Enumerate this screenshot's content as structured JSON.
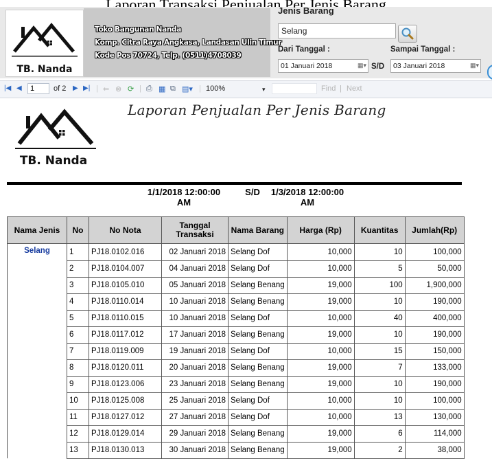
{
  "window": {
    "title": "Laporan Transaksi Penjualan Per Jenis Barang"
  },
  "company": {
    "logo_text": "TB. Nanda",
    "name": "Toko Bangunan Nanda",
    "address": "Komp. Citra Raya Angkasa, Landasan Ulin Timur",
    "contact": "Kode Pos 70724, Telp. (0511)4708039"
  },
  "filter": {
    "jenis_label": "Jenis Barang",
    "jenis_value": "Selang",
    "from_label": "Dari Tanggal :",
    "from_value": "01  Januari  2018",
    "sd_label": "S/D",
    "to_label": "Sampai Tanggal :",
    "to_value": "03  Januari  2018",
    "search_icon": "magnifier-icon"
  },
  "toolbar": {
    "page_current": "1",
    "page_of": "of 2",
    "zoom": "100%",
    "find_label": "Find",
    "separator": "|",
    "next_label": "Next"
  },
  "report": {
    "title": "Laporan Penjualan Per Jenis Barang",
    "date_from": "1/1/2018 12:00:00",
    "date_from_ampm": "AM",
    "sd": "S/D",
    "date_to": "1/3/2018 12:00:00",
    "date_to_ampm": "AM",
    "columns": [
      "Nama Jenis",
      "No",
      "No Nota",
      "Tanggal Transaksi",
      "Nama Barang",
      "Harga (Rp)",
      "Kuantitas",
      "Jumlah(Rp)"
    ],
    "group": "Selang",
    "rows": [
      {
        "no": "1",
        "nota": "PJ18.0102.016",
        "tanggal": "02 Januari 2018",
        "barang": "Selang Dof",
        "harga": "10,000",
        "qty": "10",
        "jumlah": "100,000"
      },
      {
        "no": "2",
        "nota": "PJ18.0104.007",
        "tanggal": "04 Januari 2018",
        "barang": "Selang Dof",
        "harga": "10,000",
        "qty": "5",
        "jumlah": "50,000"
      },
      {
        "no": "3",
        "nota": "PJ18.0105.010",
        "tanggal": "05 Januari 2018",
        "barang": "Selang Benang",
        "harga": "19,000",
        "qty": "100",
        "jumlah": "1,900,000"
      },
      {
        "no": "4",
        "nota": "PJ18.0110.014",
        "tanggal": "10 Januari 2018",
        "barang": "Selang Benang",
        "harga": "19,000",
        "qty": "10",
        "jumlah": "190,000"
      },
      {
        "no": "5",
        "nota": "PJ18.0110.015",
        "tanggal": "10 Januari 2018",
        "barang": "Selang Dof",
        "harga": "10,000",
        "qty": "40",
        "jumlah": "400,000"
      },
      {
        "no": "6",
        "nota": "PJ18.0117.012",
        "tanggal": "17 Januari 2018",
        "barang": "Selang Benang",
        "harga": "19,000",
        "qty": "10",
        "jumlah": "190,000"
      },
      {
        "no": "7",
        "nota": "PJ18.0119.009",
        "tanggal": "19 Januari 2018",
        "barang": "Selang Dof",
        "harga": "10,000",
        "qty": "15",
        "jumlah": "150,000"
      },
      {
        "no": "8",
        "nota": "PJ18.0120.011",
        "tanggal": "20 Januari 2018",
        "barang": "Selang Benang",
        "harga": "19,000",
        "qty": "7",
        "jumlah": "133,000"
      },
      {
        "no": "9",
        "nota": "PJ18.0123.006",
        "tanggal": "23 Januari 2018",
        "barang": "Selang Benang",
        "harga": "19,000",
        "qty": "10",
        "jumlah": "190,000"
      },
      {
        "no": "10",
        "nota": "PJ18.0125.008",
        "tanggal": "25 Januari 2018",
        "barang": "Selang Dof",
        "harga": "10,000",
        "qty": "10",
        "jumlah": "100,000"
      },
      {
        "no": "11",
        "nota": "PJ18.0127.012",
        "tanggal": "27 Januari 2018",
        "barang": "Selang Dof",
        "harga": "10,000",
        "qty": "13",
        "jumlah": "130,000"
      },
      {
        "no": "12",
        "nota": "PJ18.0129.014",
        "tanggal": "29 Januari 2018",
        "barang": "Selang Benang",
        "harga": "19,000",
        "qty": "6",
        "jumlah": "114,000"
      },
      {
        "no": "13",
        "nota": "PJ18.0130.013",
        "tanggal": "30 Januari 2018",
        "barang": "Selang Benang",
        "harga": "19,000",
        "qty": "2",
        "jumlah": "38,000"
      }
    ]
  },
  "colors": {
    "accent_blue": "#2b66c2",
    "group_text": "#1a3ea0",
    "header_bg": "#d3d3d3"
  }
}
